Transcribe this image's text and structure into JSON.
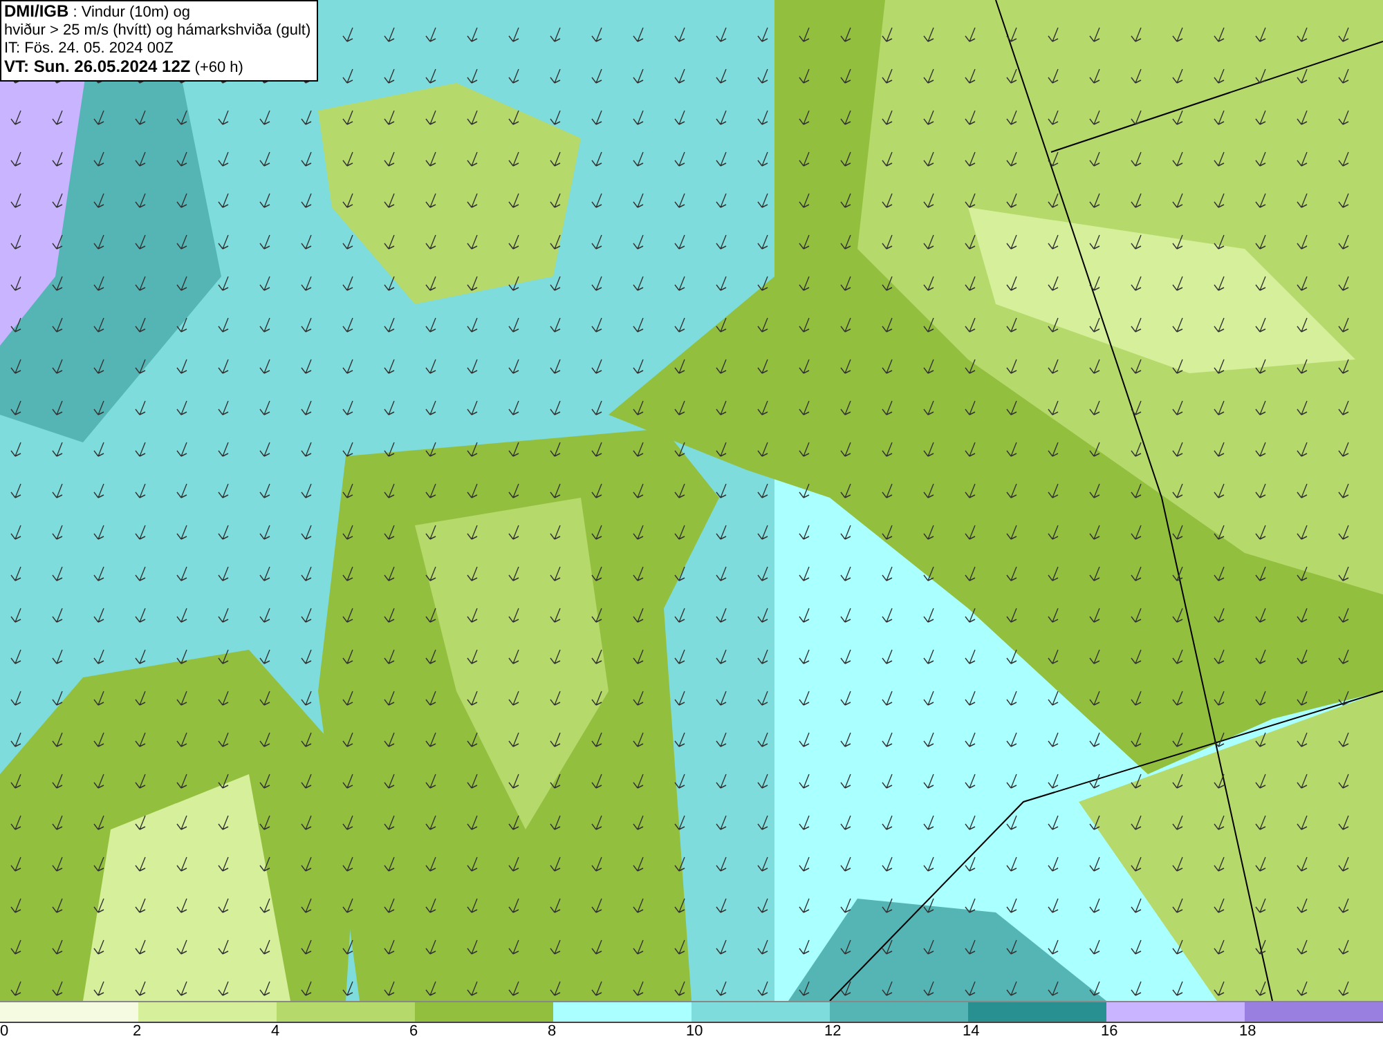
{
  "title_box": {
    "lines": [
      "**DMI/IGB** : Vindur (10m) og",
      "hviður > 25 m/s (hvítt) og hámarkshviða (gult)",
      "IT: Fös. 24. 05. 2024 00Z",
      "**VT: Sun. 26.05.2024 12Z** (+60 h)"
    ]
  },
  "legend": [
    {
      "label": "0",
      "color": "#f5fbe0"
    },
    {
      "label": "2",
      "color": "#d6ef9a"
    },
    {
      "label": "4",
      "color": "#b5d96a"
    },
    {
      "label": "6",
      "color": "#93bf3f"
    },
    {
      "label": "8",
      "color": "#aaffff"
    },
    {
      "label": "10",
      "color": "#7fdcdc"
    },
    {
      "label": "12",
      "color": "#55b5b5"
    },
    {
      "label": "14",
      "color": "#289090"
    },
    {
      "label": "16",
      "color": "#c8b4ff"
    },
    {
      "label": "18",
      "color": "#9980e0"
    }
  ]
}
